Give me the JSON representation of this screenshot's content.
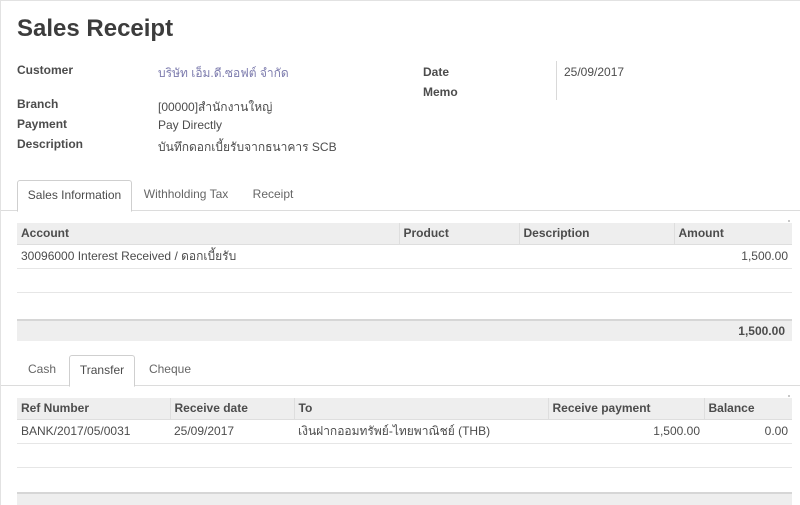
{
  "title": "Sales Receipt",
  "fields": {
    "customer_label": "Customer",
    "customer_value": "บริษัท เอ็ม.ดี.ซอฟต์ จำกัด",
    "branch_label": "Branch",
    "branch_value": "[00000]สำนักงานใหญ่",
    "payment_label": "Payment",
    "payment_value": "Pay Directly",
    "description_label": "Description",
    "description_value": "บันทึกดอกเบี้ยรับจากธนาคาร SCB",
    "date_label": "Date",
    "date_value": "25/09/2017",
    "memo_label": "Memo",
    "memo_value": ""
  },
  "tabs": [
    {
      "label": "Sales Information",
      "active": true
    },
    {
      "label": "Withholding Tax",
      "active": false
    },
    {
      "label": "Receipt",
      "active": false
    }
  ],
  "lines_table": {
    "headers": [
      "Account",
      "Product",
      "Description",
      "Amount"
    ],
    "rows": [
      {
        "account": "30096000 Interest Received / ดอกเบี้ยรับ",
        "product": "",
        "description": "",
        "amount": "1,500.00"
      }
    ],
    "total": "1,500.00"
  },
  "payment_tabs": [
    {
      "label": "Cash",
      "active": false
    },
    {
      "label": "Transfer",
      "active": true
    },
    {
      "label": "Cheque",
      "active": false
    }
  ],
  "transfer_table": {
    "headers": [
      "Ref Number",
      "Receive date",
      "To",
      "Receive payment",
      "Balance"
    ],
    "rows": [
      {
        "ref": "BANK/2017/05/0031",
        "date": "25/09/2017",
        "to": "เงินฝากออมทรัพย์-ไทยพาณิชย์ (THB)",
        "receive": "1,500.00",
        "balance": "0.00"
      }
    ]
  }
}
